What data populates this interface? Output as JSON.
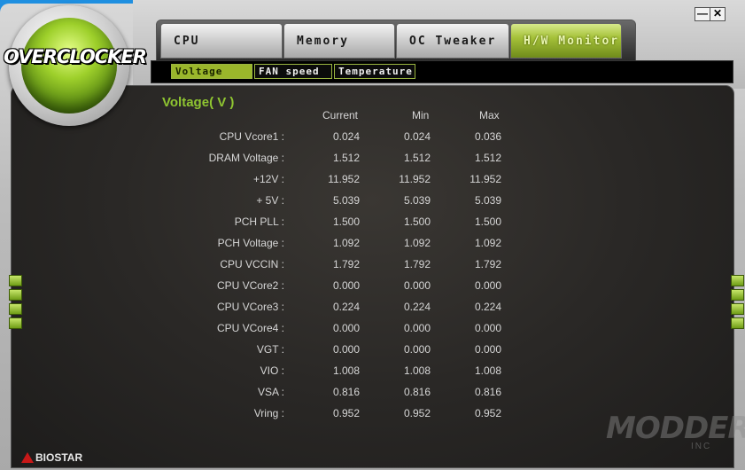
{
  "window": {
    "minimize_label": "—",
    "close_label": "✕"
  },
  "logo": {
    "text": "OVERCLOCKER"
  },
  "tabs": [
    {
      "label": "CPU",
      "active": false
    },
    {
      "label": "Memory",
      "active": false
    },
    {
      "label": "OC Tweaker",
      "active": false
    },
    {
      "label": "H/W Monitor",
      "active": true
    }
  ],
  "subtabs": [
    {
      "label": "Voltage",
      "active": true
    },
    {
      "label": "FAN speed",
      "active": false
    },
    {
      "label": "Temperature",
      "active": false
    }
  ],
  "section": {
    "title": "Voltage( V )"
  },
  "columns": [
    "Current",
    "Min",
    "Max"
  ],
  "rows": [
    {
      "label": "CPU Vcore1 :",
      "current": "0.024",
      "min": "0.024",
      "max": "0.036"
    },
    {
      "label": "DRAM Voltage :",
      "current": "1.512",
      "min": "1.512",
      "max": "1.512"
    },
    {
      "label": "+12V :",
      "current": "11.952",
      "min": "11.952",
      "max": "11.952"
    },
    {
      "label": "+ 5V :",
      "current": "5.039",
      "min": "5.039",
      "max": "5.039"
    },
    {
      "label": "PCH PLL :",
      "current": "1.500",
      "min": "1.500",
      "max": "1.500"
    },
    {
      "label": "PCH Voltage :",
      "current": "1.092",
      "min": "1.092",
      "max": "1.092"
    },
    {
      "label": "CPU VCCIN :",
      "current": "1.792",
      "min": "1.792",
      "max": "1.792"
    },
    {
      "label": "CPU VCore2 :",
      "current": "0.000",
      "min": "0.000",
      "max": "0.000"
    },
    {
      "label": "CPU VCore3 :",
      "current": "0.224",
      "min": "0.224",
      "max": "0.224"
    },
    {
      "label": "CPU VCore4 :",
      "current": "0.000",
      "min": "0.000",
      "max": "0.000"
    },
    {
      "label": "VGT :",
      "current": "0.000",
      "min": "0.000",
      "max": "0.000"
    },
    {
      "label": "VIO :",
      "current": "1.008",
      "min": "1.008",
      "max": "1.008"
    },
    {
      "label": "VSA :",
      "current": "0.816",
      "min": "0.816",
      "max": "0.816"
    },
    {
      "label": "Vring :",
      "current": "0.952",
      "min": "0.952",
      "max": "0.952"
    }
  ],
  "brand": {
    "name": "BIOSTAR"
  },
  "watermark": {
    "main": "MODDERS",
    "sub": "INC"
  },
  "colors": {
    "accent": "#9ab62b",
    "title": "#8fc531",
    "panel": "#2a2826"
  }
}
